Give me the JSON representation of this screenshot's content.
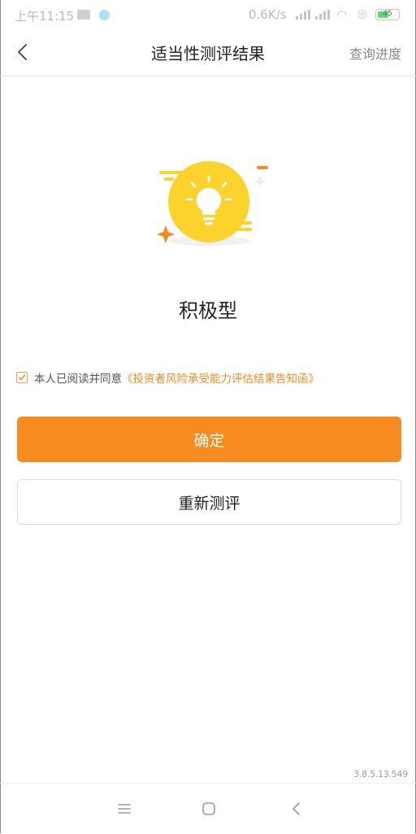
{
  "status_bar": {
    "time": "上午11:15",
    "network_speed": "0.6K/s",
    "battery": "45"
  },
  "header": {
    "title": "适当性测评结果",
    "action_label": "查询进度"
  },
  "result": {
    "type_label": "积极型"
  },
  "agreement": {
    "checked": true,
    "prefix_text": "本人已阅读并同意",
    "link_text": "《投资者风险承受能力评估结果告知函》"
  },
  "buttons": {
    "confirm_label": "确定",
    "retest_label": "重新测评"
  },
  "footer": {
    "version": "3.8.5.13.549"
  },
  "colors": {
    "accent": "#f78b1f",
    "link": "#f58a1f",
    "bulb_circle": "#fcd22d"
  },
  "icons": {
    "back": "chevron-left-icon",
    "bulb": "lightbulb-icon",
    "checkbox": "check-icon",
    "sys_menu": "menu-icon",
    "sys_home": "home-square-icon",
    "sys_back": "back-icon"
  }
}
